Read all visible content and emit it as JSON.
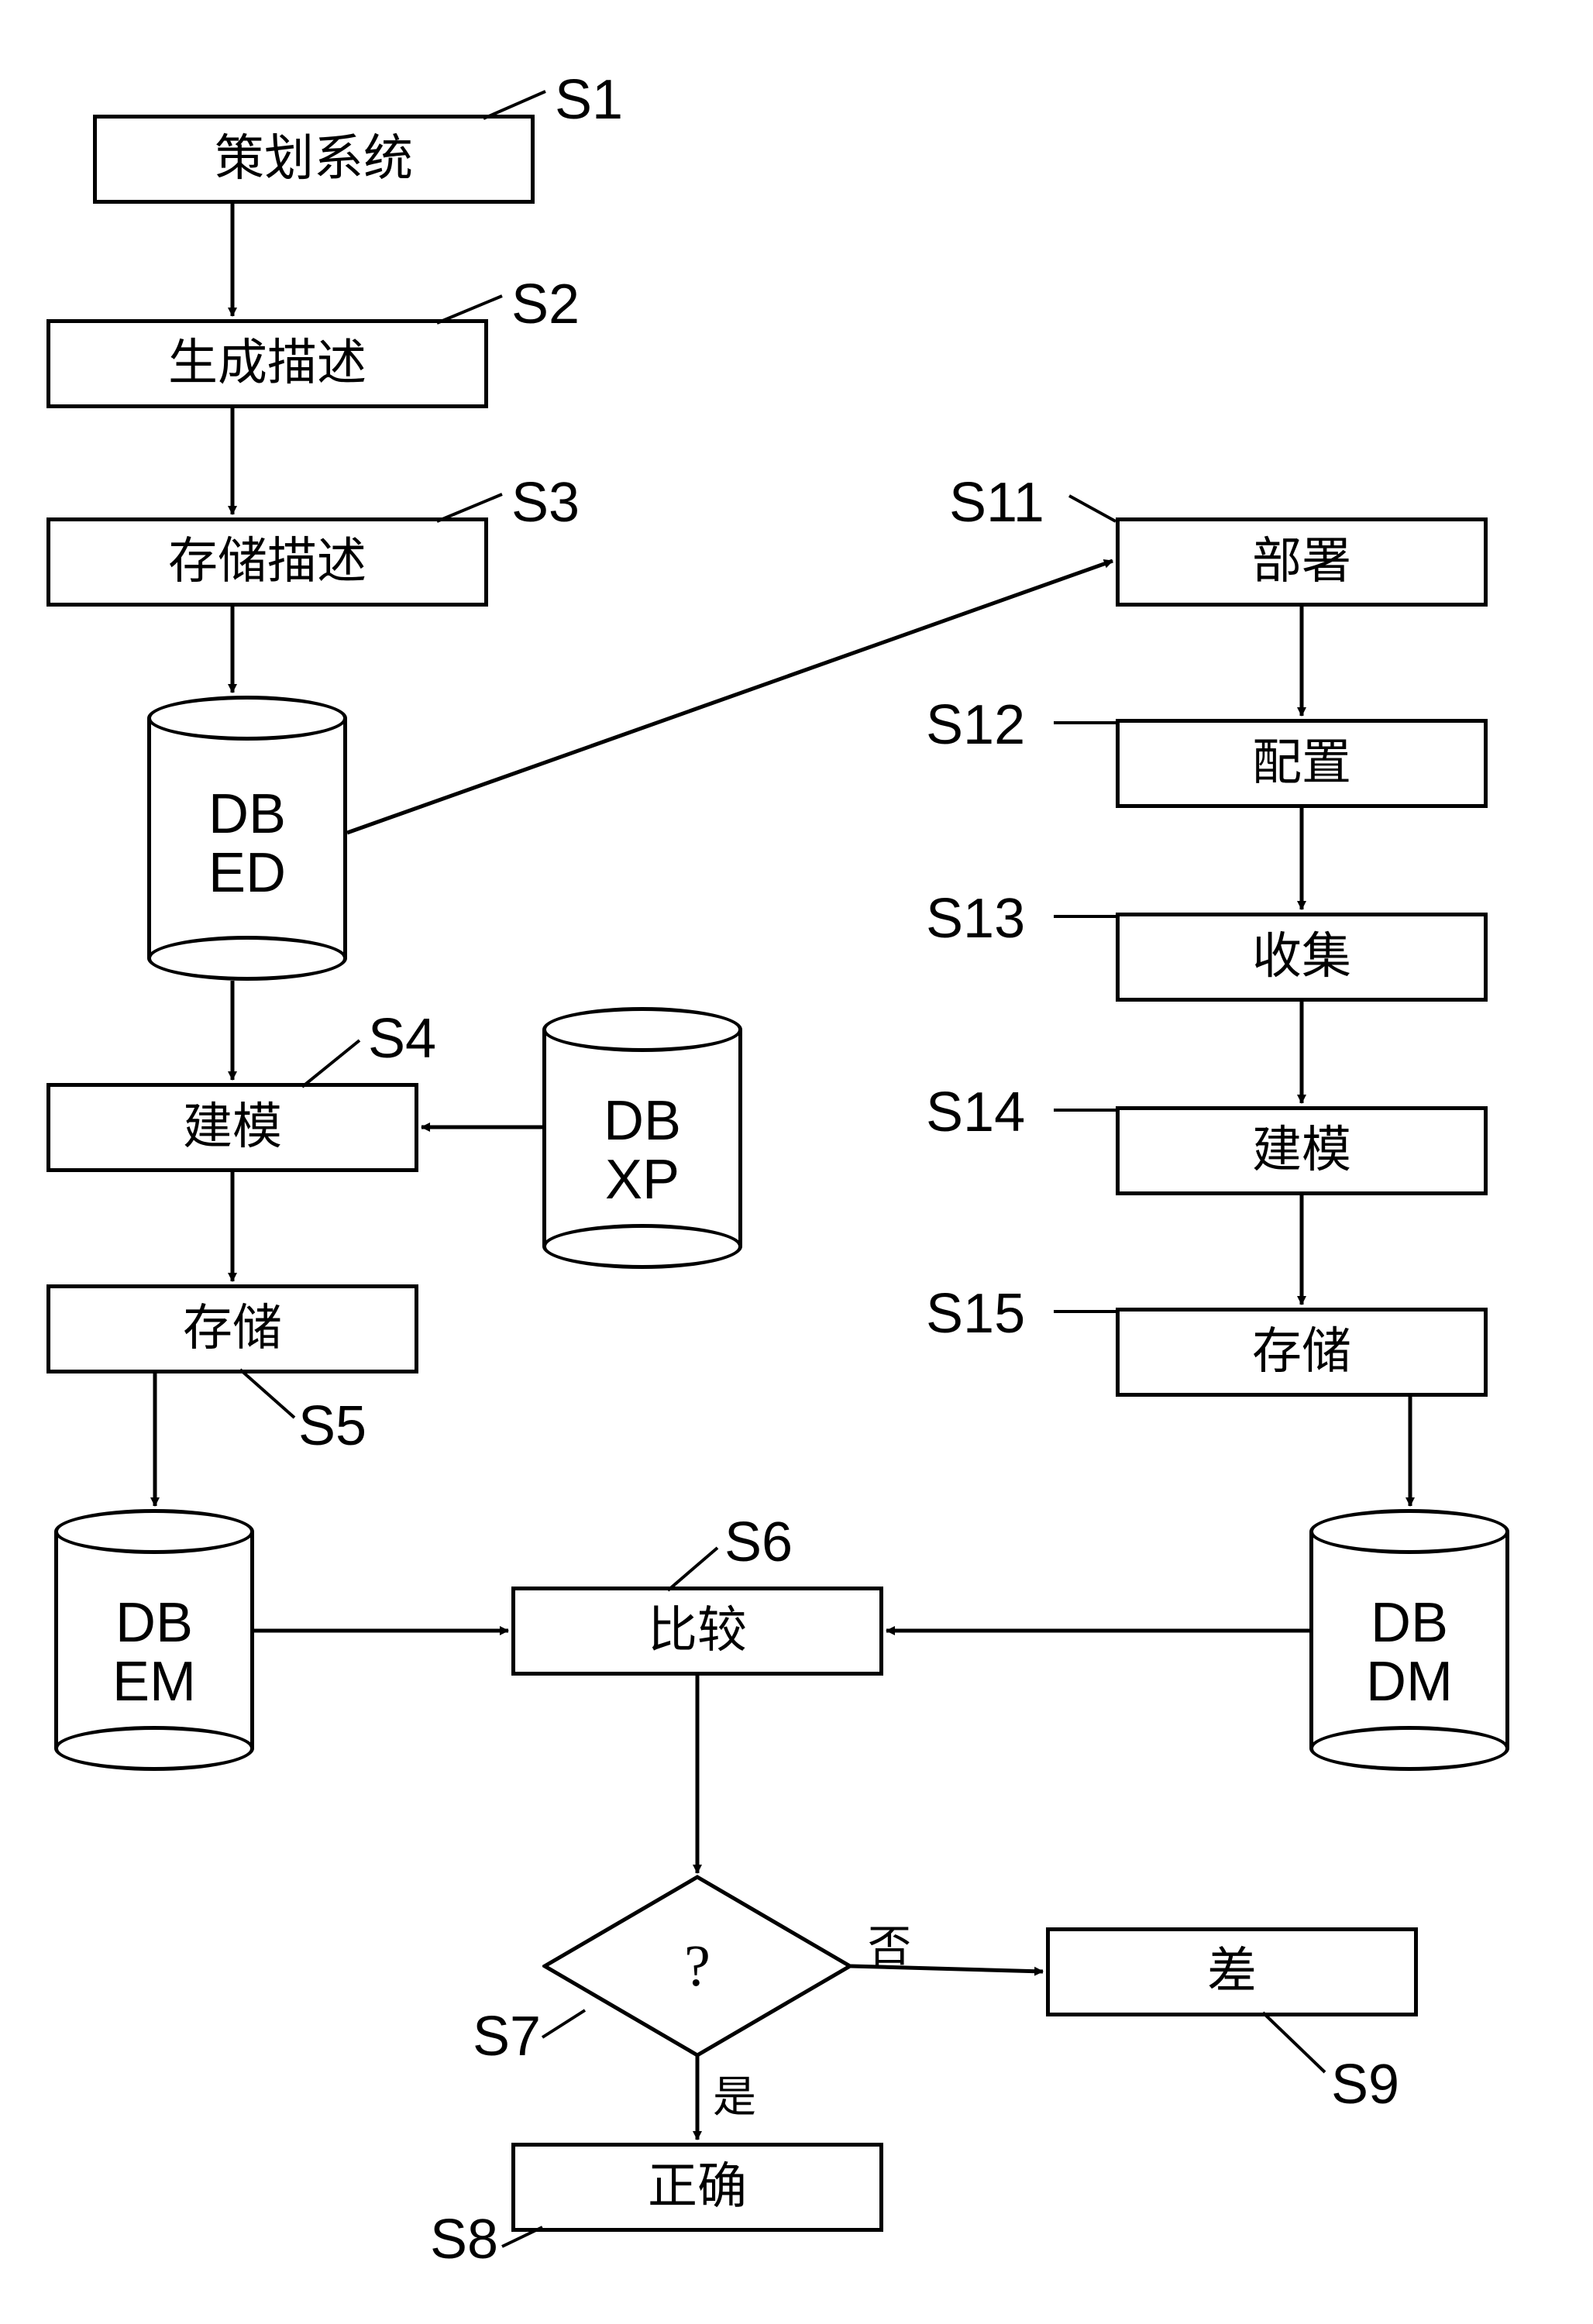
{
  "steps": {
    "s1": {
      "label": "策划系统",
      "tag": "S1"
    },
    "s2": {
      "label": "生成描述",
      "tag": "S2"
    },
    "s3": {
      "label": "存储描述",
      "tag": "S3"
    },
    "s4": {
      "label": "建模",
      "tag": "S4"
    },
    "s5": {
      "label": "存储",
      "tag": "S5"
    },
    "s6": {
      "label": "比较",
      "tag": "S6"
    },
    "s7": {
      "label": "?",
      "tag": "S7"
    },
    "s8": {
      "label": "正确",
      "tag": "S8"
    },
    "s9": {
      "label": "差",
      "tag": "S9"
    },
    "s11": {
      "label": "部署",
      "tag": "S11"
    },
    "s12": {
      "label": "配置",
      "tag": "S12"
    },
    "s13": {
      "label": "收集",
      "tag": "S13"
    },
    "s14": {
      "label": "建模",
      "tag": "S14"
    },
    "s15": {
      "label": "存储",
      "tag": "S15"
    }
  },
  "databases": {
    "dbed": {
      "line1": "DB",
      "line2": "ED"
    },
    "dbxp": {
      "line1": "DB",
      "line2": "XP"
    },
    "dbem": {
      "line1": "DB",
      "line2": "EM"
    },
    "dbdm": {
      "line1": "DB",
      "line2": "DM"
    }
  },
  "branches": {
    "yes": "是",
    "no": "否"
  }
}
